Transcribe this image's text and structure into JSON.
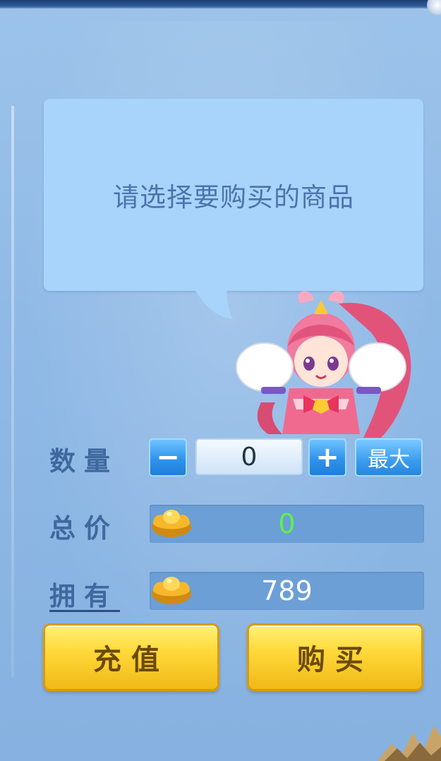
{
  "dialog": {
    "prompt": "请选择要购买的商品"
  },
  "quantity": {
    "label": "数量",
    "minus_label": "−",
    "value": "0",
    "plus_label": "+",
    "max_label": "最大"
  },
  "total": {
    "label": "总价",
    "value": "0",
    "value_color": "#5cf24a"
  },
  "owned": {
    "label": "拥有",
    "value": "789",
    "value_color": "#ffffff"
  },
  "actions": {
    "recharge_label": "充值",
    "buy_label": "购买"
  },
  "icons": {
    "currency": "gold-ingot-icon",
    "mascot": "mascot-girl"
  }
}
